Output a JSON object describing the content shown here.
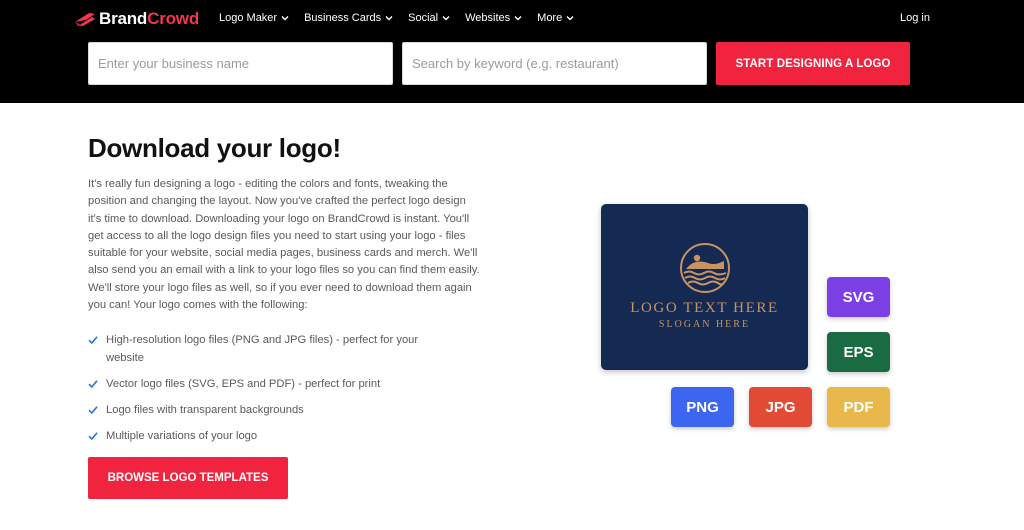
{
  "header": {
    "brand_part1": "Brand",
    "brand_part2": "Crowd",
    "nav": [
      {
        "label": "Logo Maker"
      },
      {
        "label": "Business Cards"
      },
      {
        "label": "Social"
      },
      {
        "label": "Websites"
      },
      {
        "label": "More"
      }
    ],
    "login_label": "Log in",
    "business_name_placeholder": "Enter your business name",
    "keyword_placeholder": "Search by keyword (e.g. restaurant)",
    "start_button_label": "START DESIGNING A LOGO"
  },
  "main": {
    "title": "Download your logo!",
    "body": "It's really fun designing a logo - editing the colors and fonts, tweaking the position and changing the layout. Now you've crafted the perfect logo design it's time to download. Downloading your logo on BrandCrowd is instant. You'll get access to all the logo design files you need to start using your logo - files suitable for your website, social media pages, business cards and merch. We'll also send you an email with a link to your logo files so you can find them easily. We'll store your logo files as well, so if you ever need to download them again you can! Your logo comes with the following:",
    "features": [
      "High-resolution logo files (PNG and JPG files) - perfect for your website",
      "Vector logo files (SVG, EPS and PDF) - perfect for print",
      "Logo files with transparent backgrounds",
      "Multiple variations of your logo"
    ],
    "browse_button_label": "BROWSE LOGO TEMPLATES"
  },
  "preview": {
    "logo_text": "LOGO TEXT HERE",
    "slogan": "SLOGAN HERE"
  },
  "formats": [
    "SVG",
    "EPS",
    "PNG",
    "JPG",
    "PDF"
  ],
  "colors": {
    "accent": "#f0243f",
    "header_bg": "#000000",
    "preview_bg": "#142a52",
    "logo_gold": "#c89362",
    "svg": "#7b3fe4",
    "eps": "#1a6b41",
    "png": "#3d66f0",
    "jpg": "#e34a35",
    "pdf": "#e8b84b",
    "check": "#2f6fd9"
  },
  "icons": [
    "brandcrowd-logo-icon",
    "chevron-down-icon",
    "check-icon",
    "swimmer-emblem-icon"
  ]
}
